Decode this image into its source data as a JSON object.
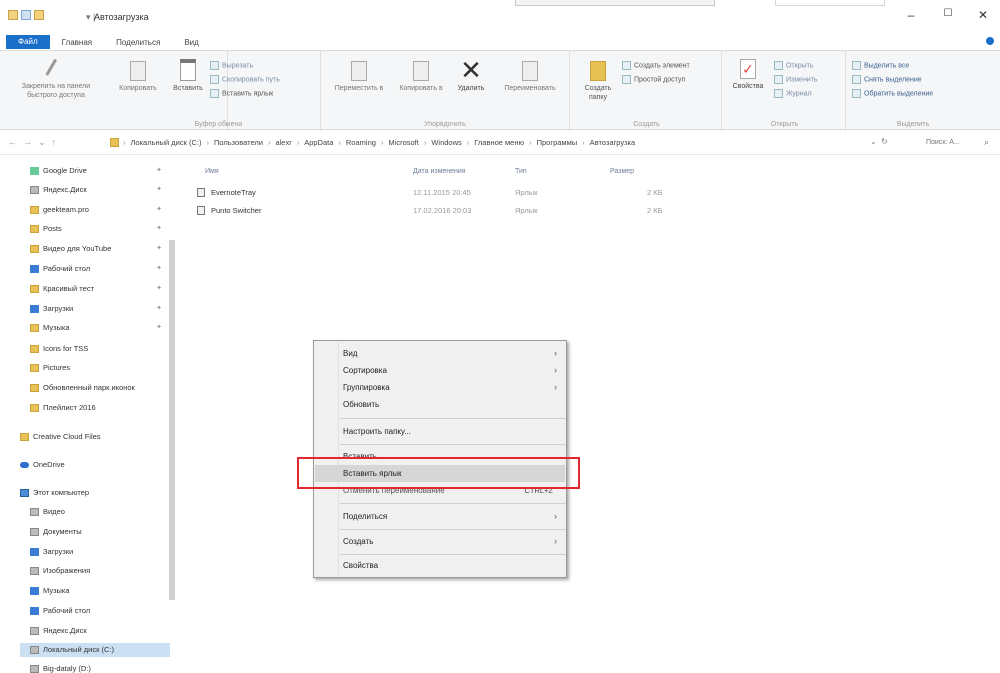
{
  "window": {
    "title": "Автозагрузка",
    "minimize": "–",
    "maximize": "☐",
    "close": "✕"
  },
  "ribbon": {
    "tabs": [
      "Файл",
      "Главная",
      "Поделиться",
      "Вид"
    ],
    "clipboard": {
      "pin": "Закрепить на панели быстрого доступа",
      "copy": "Копировать",
      "paste": "Вставить",
      "cut": "Вырезать",
      "copy_path": "Скопировать путь",
      "paste_shortcut": "Вставить ярлык",
      "group": "Буфер обмена"
    },
    "organize": {
      "move_to": "Переместить в",
      "copy_to": "Копировать в",
      "delete": "Удалить",
      "rename": "Переименовать",
      "group": "Упорядочить"
    },
    "new": {
      "new_folder": "Создать папку",
      "new_item": "Создать элемент",
      "easy_access": "Простой доступ",
      "group": "Создать"
    },
    "open": {
      "properties": "Свойства",
      "open": "Открыть",
      "edit": "Изменить",
      "history": "Журнал",
      "group": "Открыть"
    },
    "select": {
      "select_all": "Выделить все",
      "select_none": "Снять выделение",
      "invert": "Обратить выделение",
      "group": "Выделить"
    }
  },
  "address": {
    "crumbs": [
      "Локальный диск (C:)",
      "Пользователи",
      "alexr",
      "AppData",
      "Roaming",
      "Microsoft",
      "Windows",
      "Главное меню",
      "Программы",
      "Автозагрузка"
    ],
    "search_placeholder": "Поиск: А..."
  },
  "nav": {
    "items": [
      {
        "label": "Google Drive",
        "icon": "google-drive-icon",
        "pinned": true
      },
      {
        "label": "Яндекс.Диск",
        "icon": "yandex-disk-icon",
        "pinned": true
      },
      {
        "label": "geekteam.pro",
        "icon": "folder-icon",
        "pinned": true
      },
      {
        "label": "Posts",
        "icon": "folder-icon",
        "pinned": true
      },
      {
        "label": "Видео для YouTube",
        "icon": "folder-icon",
        "pinned": true
      },
      {
        "label": "Рабочий стол",
        "icon": "desktop-icon",
        "pinned": true
      },
      {
        "label": "Красивый тест",
        "icon": "folder-icon",
        "pinned": true
      },
      {
        "label": "Загрузки",
        "icon": "downloads-icon",
        "pinned": true
      },
      {
        "label": "Музыка",
        "icon": "folder-icon",
        "pinned": true
      },
      {
        "label": "Icons for TSS",
        "icon": "folder-icon",
        "pinned": false
      },
      {
        "label": "Pictures",
        "icon": "folder-icon",
        "pinned": false
      },
      {
        "label": "Обновленный парк.иконок",
        "icon": "folder-icon",
        "pinned": false
      },
      {
        "label": "Плейлист 2016",
        "icon": "folder-icon",
        "pinned": false
      },
      {
        "label": "Creative Cloud Files",
        "icon": "creative-cloud-icon",
        "pinned": false
      },
      {
        "label": "OneDrive",
        "icon": "onedrive-icon",
        "pinned": false
      },
      {
        "label": "Этот компьютер",
        "icon": "this-pc-icon",
        "pinned": false
      },
      {
        "label": "Видео",
        "icon": "video-icon",
        "pinned": false
      },
      {
        "label": "Документы",
        "icon": "documents-icon",
        "pinned": false
      },
      {
        "label": "Загрузки",
        "icon": "downloads-icon",
        "pinned": false
      },
      {
        "label": "Изображения",
        "icon": "pictures-icon",
        "pinned": false
      },
      {
        "label": "Музыка",
        "icon": "music-icon",
        "pinned": false
      },
      {
        "label": "Рабочий стол",
        "icon": "desktop-icon",
        "pinned": false
      },
      {
        "label": "Яндекс.Диск",
        "icon": "yandex-disk-icon",
        "pinned": false
      },
      {
        "label": "Локальный диск (C:)",
        "icon": "drive-icon",
        "pinned": false,
        "selected": true
      },
      {
        "label": "Big-dataly (D:)",
        "icon": "drive-icon",
        "pinned": false
      }
    ]
  },
  "files": {
    "columns": [
      "Имя",
      "Дата изменения",
      "Тип",
      "Размер"
    ],
    "rows": [
      {
        "name": "EvernoteTray",
        "date": "12.11.2015 20:45",
        "type": "Ярлык",
        "size": "2 КБ"
      },
      {
        "name": "Punto Switcher",
        "date": "17.02.2016 20:03",
        "type": "Ярлык",
        "size": "2 КБ"
      }
    ]
  },
  "context_menu": {
    "items": [
      {
        "label": "Вид",
        "submenu": true
      },
      {
        "label": "Сортировка",
        "submenu": true
      },
      {
        "label": "Группировка",
        "submenu": true
      },
      {
        "label": "Обновить",
        "submenu": false
      },
      {
        "label": "Настроить папку...",
        "submenu": false
      },
      {
        "label": "Вставить",
        "submenu": false
      },
      {
        "label": "Вставить ярлык",
        "submenu": false,
        "highlighted": true
      },
      {
        "label": "Отменить переименование",
        "shortcut": "CTRL+Z",
        "submenu": false
      },
      {
        "label": "Поделиться",
        "submenu": true
      },
      {
        "label": "Создать",
        "submenu": true
      },
      {
        "label": "Свойства",
        "submenu": false
      }
    ]
  },
  "colors": {
    "accent": "#1a6fc9",
    "highlight_border": "#e0282e",
    "nav_selected": "#cce0f4"
  }
}
